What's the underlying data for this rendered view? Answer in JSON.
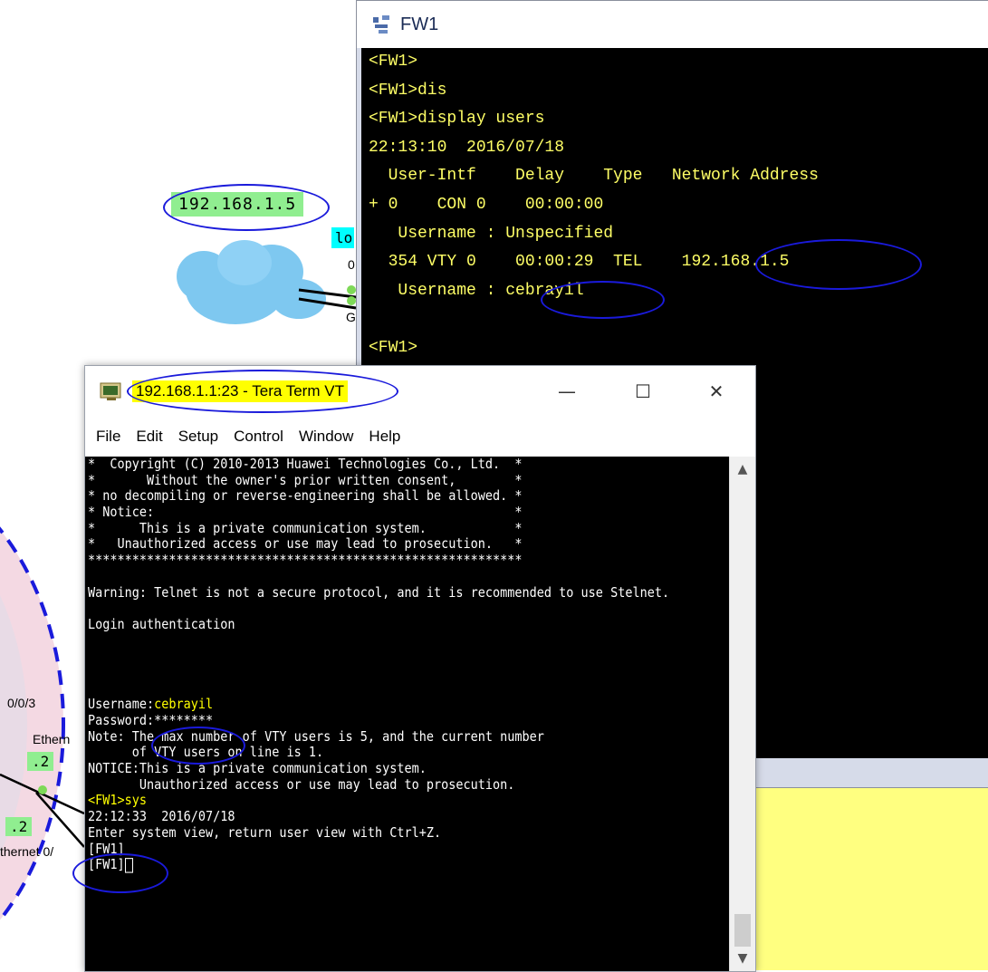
{
  "topology": {
    "cloud_ip": "192.168.1.5",
    "lo_label": "lo",
    "port_a": "0",
    "port_g": "G",
    "interface_label": "0/0/3",
    "ethernet_label_1": "Ethern",
    "ethernet_label_2": "thernet 0/",
    "addr_tag_1": ".2",
    "addr_tag_2": ".2"
  },
  "fw1_window": {
    "title": "FW1",
    "lines": [
      "<FW1>",
      "<FW1>dis",
      "<FW1>display users",
      "22:13:10  2016/07/18",
      "  User-Intf    Delay    Type   Network Address",
      "+ 0    CON 0    00:00:00",
      "   Username : Unspecified",
      "  354 VTY 0    00:00:29  TEL    192.168.1.5",
      "   Username : cebrayil",
      "",
      "<FW1>"
    ]
  },
  "teraterm": {
    "title": "192.168.1.1:23 - Tera Term VT",
    "minimize": "—",
    "maximize": "☐",
    "close": "✕",
    "menu": [
      "File",
      "Edit",
      "Setup",
      "Control",
      "Window",
      "Help"
    ],
    "lines": [
      "*  Copyright (C) 2010-2013 Huawei Technologies Co., Ltd.  *",
      "*       Without the owner's prior written consent,        *",
      "* no decompiling or reverse-engineering shall be allowed. *",
      "* Notice:                                                 *",
      "*      This is a private communication system.            *",
      "*   Unauthorized access or use may lead to prosecution.   *",
      "***********************************************************",
      "",
      "Warning: Telnet is not a secure protocol, and it is recommended to use Stelnet.",
      "",
      "Login authentication",
      "",
      "",
      "",
      "",
      "Username:cebrayil",
      "Password:********",
      "Note: The max number of VTY users is 5, and the current number",
      "      of VTY users on line is 1.",
      "NOTICE:This is a private communication system.",
      "       Unauthorized access or use may lead to prosecution.",
      "<FW1>sys",
      "22:12:33  2016/07/18",
      "Enter system view, return user view with Ctrl+Z.",
      "[FW1]",
      "[FW1]"
    ],
    "scroll_up": "▲",
    "scroll_down": "▼"
  },
  "colors": {
    "fw_text": "#ffff66",
    "tt_text": "#ffffff",
    "highlight_yellow": "#ffff00",
    "circle_blue": "#1a1adb",
    "tag_green": "#90ee90"
  }
}
